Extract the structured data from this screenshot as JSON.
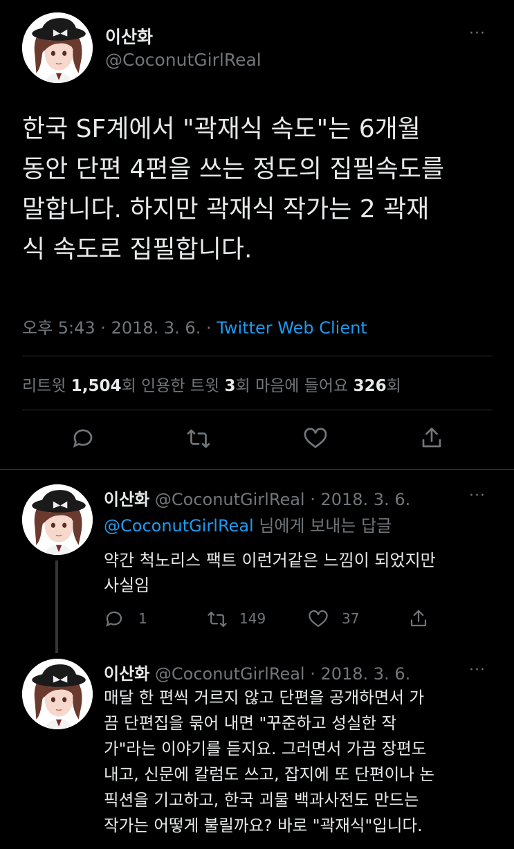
{
  "main_tweet": {
    "display_name": "이산화",
    "handle": "@CoconutGirlReal",
    "text_lines": [
      "한국 SF계에서 \"곽재식 속도\"는 6개월",
      "동안 단편 4편을 쓰는 정도의 집필속도를",
      "말합니다. 하지만 곽재식 작가는 2 곽재",
      "식 속도로 집필합니다."
    ],
    "time": "오후 5:43 · 2018. 3. 6. · ",
    "client": "Twitter Web Client",
    "stats": {
      "retweets_label": "리트윗 ",
      "retweets_count": "1,504",
      "retweets_suffix": "회  ",
      "quotes_label": "인용한 트윗 ",
      "quotes_count": "3",
      "quotes_suffix": "회  ",
      "likes_label": "마음에 들어요 ",
      "likes_count": "326",
      "likes_suffix": "회"
    }
  },
  "replies": [
    {
      "display_name": "이산화",
      "handle_date": "@CoconutGirlReal · 2018. 3. 6.",
      "reply_to_handle": "@CoconutGirlReal",
      "reply_to_suffix": " 님에게 보내는 답글",
      "text_lines": [
        "약간 척노리스 팩트 이런거같은 느낌이 되었지만",
        "사실임"
      ],
      "reply_count": "1",
      "retweet_count": "149",
      "like_count": "37"
    },
    {
      "display_name": "이산화",
      "handle_date": "@CoconutGirlReal · 2018. 3. 6.",
      "text_lines": [
        "매달 한 편씩 거르지 않고 단편을 공개하면서 가",
        "끔 단편집을 묶어 내면 \"꾸준하고 성실한 작",
        "가\"라는 이야기를 듣지요. 그러면서 가끔 장편도",
        "내고, 신문에 칼럼도 쓰고, 잡지에 또 단편이나 논",
        "픽션을 기고하고, 한국 괴물 백과사전도 만드는",
        "작가는 어떻게 불릴까요? 바로 \"곽재식\"입니다."
      ]
    }
  ],
  "more_glyph": "···",
  "colors": {
    "background": "#000000",
    "text": "#e7e9ea",
    "muted": "#71767b",
    "link": "#1d9bf0",
    "divider": "#2f3336"
  }
}
